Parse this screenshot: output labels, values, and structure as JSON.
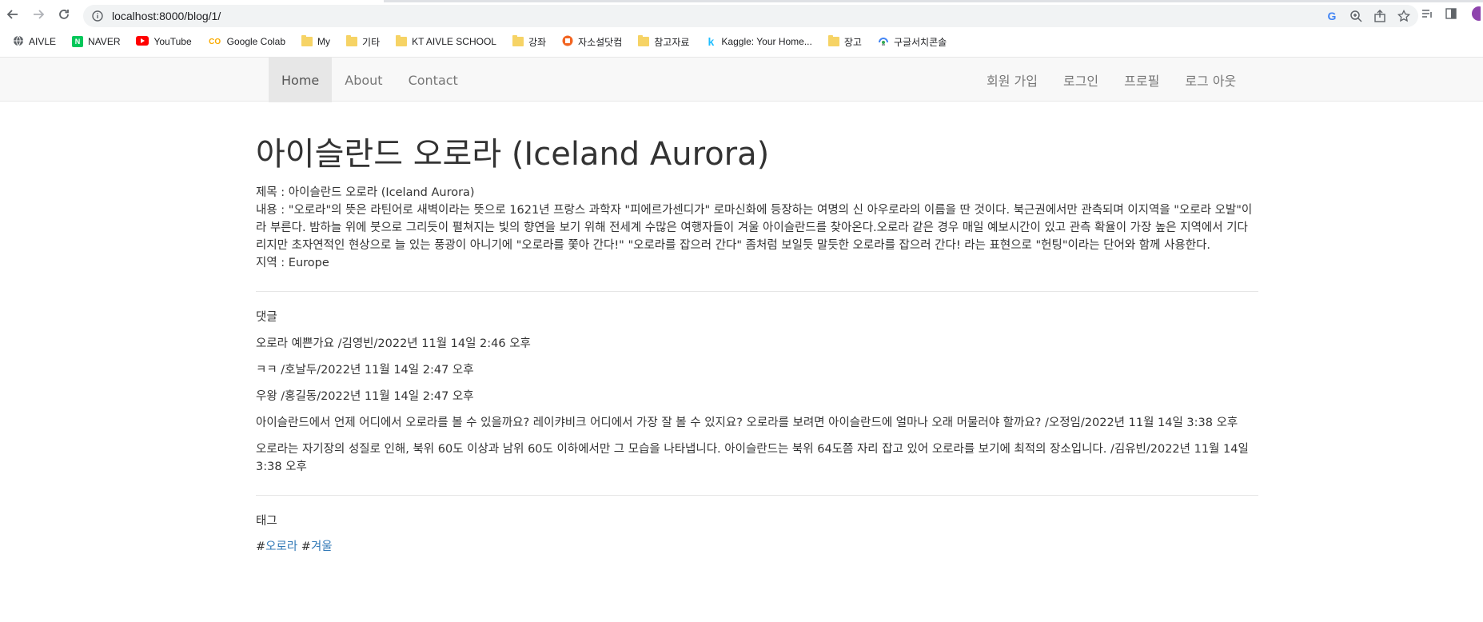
{
  "browser": {
    "url": "localhost:8000/blog/1/",
    "google_letter": "G"
  },
  "bookmarks": [
    {
      "label": "AIVLE",
      "icon": "globe-icon"
    },
    {
      "label": "NAVER",
      "icon": "naver-icon",
      "badge": "N",
      "color": "#03c75a"
    },
    {
      "label": "YouTube",
      "icon": "youtube-icon",
      "color": "#ff0000"
    },
    {
      "label": "Google Colab",
      "icon": "colab-icon",
      "badge": "CO",
      "color": "#f9ab00"
    },
    {
      "label": "My",
      "icon": "folder-icon"
    },
    {
      "label": "기타",
      "icon": "folder-icon"
    },
    {
      "label": "KT AIVLE SCHOOL",
      "icon": "folder-icon"
    },
    {
      "label": "강좌",
      "icon": "folder-icon"
    },
    {
      "label": "자소설닷컴",
      "icon": "jasoseol-icon",
      "color": "#f26522"
    },
    {
      "label": "참고자료",
      "icon": "folder-icon"
    },
    {
      "label": "Kaggle: Your Home...",
      "icon": "kaggle-icon",
      "badge": "k",
      "color": "#20beff"
    },
    {
      "label": "장고",
      "icon": "folder-icon"
    },
    {
      "label": "구글서치콘솔",
      "icon": "search-console-icon"
    }
  ],
  "nav": {
    "home": "Home",
    "about": "About",
    "contact": "Contact",
    "signup": "회원 가입",
    "login": "로그인",
    "profile": "프로필",
    "logout": "로그 아웃"
  },
  "post": {
    "title": "아이슬란드 오로라 (Iceland Aurora)",
    "subject_line": "제목 : 아이슬란드 오로라 (Iceland Aurora)",
    "content_line": "내용 : \"오로라\"의 뜻은 라틴어로 새벽이라는 뜻으로 1621년 프랑스 과학자 \"피에르가센디가\" 로마신화에 등장하는 여명의 신 아우로라의 이름을 딴 것이다. 북근권에서만 관측되며 이지역을 \"오로라 오발\"이라 부른다. 밤하늘 위에 붓으로 그리듯이 펼쳐지는 빛의 향연을 보기 위해 전세계 수많은 여행자들이 겨울 아이슬란드를 찾아온다.오로라 같은 경우 매일 예보시간이 있고 관측 확율이 가장 높은 지역에서 기다리지만 초자연적인 현상으로 늘 있는 풍광이 아니기에 \"오로라를 쫓아 간다!\" \"오로라를 잡으러 간다\" 좀처럼 보일듯 말듯한 오로라를 잡으러 간다! 라는 표현으로 \"헌팅\"이라는 단어와 함께 사용한다.",
    "region_line": "지역 : Europe"
  },
  "comments": {
    "heading": "댓글",
    "items": [
      "오로라 예쁜가요 /김영빈/2022년 11월 14일 2:46 오후",
      "ㅋㅋ /호날두/2022년 11월 14일 2:47 오후",
      "우왕 /홍길동/2022년 11월 14일 2:47 오후",
      "아이슬란드에서 언제 어디에서 오로라를 볼 수 있을까요? 레이캬비크 어디에서 가장 잘 볼 수 있지요? 오로라를 보려면 아이슬란드에 얼마나 오래 머물러야 할까요? /오정임/2022년 11월 14일 3:38 오후",
      "오로라는 자기장의 성질로 인해, 북위 60도 이상과 남위 60도 이하에서만 그 모습을 나타냅니다. 아이슬란드는 북위 64도쯤 자리 잡고 있어 오로라를 보기에 최적의 장소입니다. /김유빈/2022년 11월 14일 3:38 오후"
    ]
  },
  "tags": {
    "heading": "태그",
    "hash": "#",
    "items": [
      "오로라",
      "겨울"
    ]
  },
  "colors": {
    "link": "#337ab7",
    "navbar_bg": "#f8f8f8",
    "nav_active_bg": "#e7e7e7"
  }
}
